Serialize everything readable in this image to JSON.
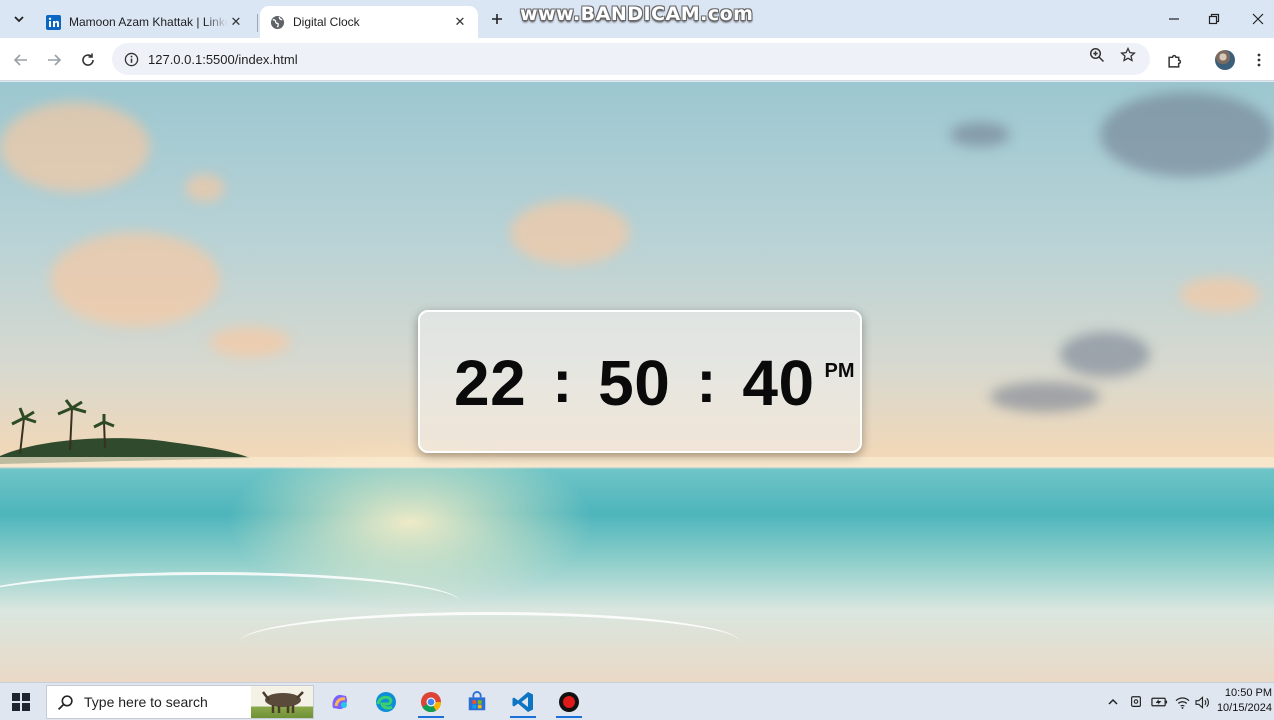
{
  "browser": {
    "tabs": [
      {
        "title": "Mamoon Azam Khattak | LinkedIn",
        "favicon": "linkedin-icon",
        "active": false
      },
      {
        "title": "Digital Clock",
        "favicon": "globe-icon",
        "active": true
      }
    ],
    "watermark": "www.BANDICAM.com",
    "url": "127.0.0.1:5500/index.html"
  },
  "clock": {
    "hours": "22",
    "minutes": "50",
    "seconds": "40",
    "separator": ":",
    "ampm": "PM"
  },
  "taskbar": {
    "search_placeholder": "Type here to search",
    "time": "10:50 PM",
    "date": "10/15/2024",
    "apps": [
      "copilot-icon",
      "edge-icon",
      "chrome-icon",
      "store-icon",
      "vscode-icon",
      "bandicam-icon"
    ]
  },
  "colors": {
    "linkedin": "#0a66c2",
    "accent": "#1b6fd8",
    "bandicam_red": "#e01919"
  }
}
